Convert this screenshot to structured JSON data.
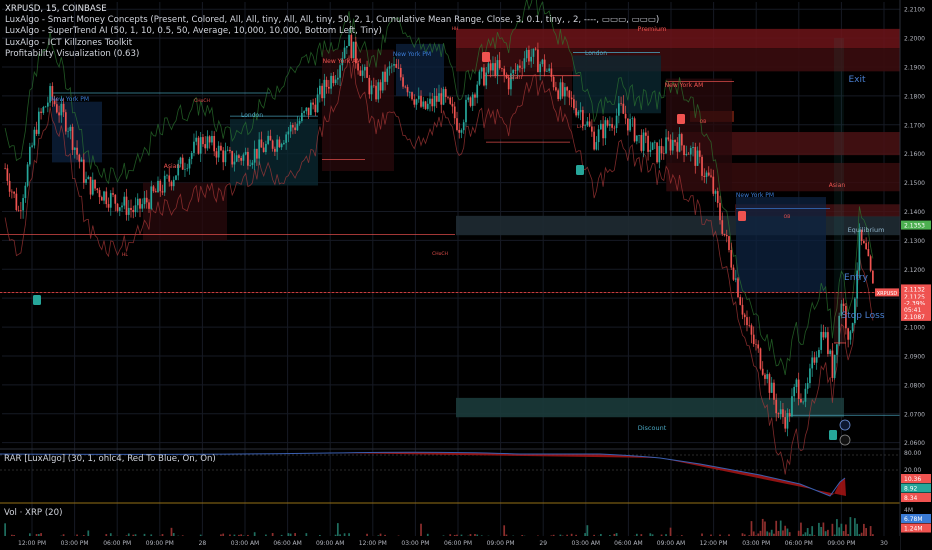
{
  "legend": {
    "symbol_line": "XRPUSD, 15, COINBASE",
    "indicators": [
      "LuxAlgo - Smart Money Concepts (Present, Colored, All, All, tiny, All, All, tiny, 50, 2, 1, Cumulative Mean Range, Close, 3, 0.1, tiny, , 2, ----, ▭▭▭, ▭▭▭)",
      "LuxAlgo - SuperTrend AI (50, 1, 10, 0.5, 50, Average, 10,000, 10,000, Bottom Left, Tiny)",
      "LuxAlgo - ICT Killzones Toolkit",
      "Profitability Visualization (0.63)"
    ]
  },
  "rar_label": "RAR [LuxAlgo] (30, 1, ohlc4, Red To Blue, On, On)",
  "vol_label": "Vol · XRP (20)",
  "colors": {
    "up": "#26a69a",
    "down": "#ef5350",
    "premium": "#8b1f24",
    "discount": "#1b3b3b",
    "session_ny": "#3a7bd5",
    "session_london": "#4aa6c0",
    "grid": "#161a24"
  },
  "price_axis": {
    "ticks": [
      "2.2100",
      "2.2000",
      "2.1900",
      "2.1800",
      "2.1700",
      "2.1600",
      "2.1500",
      "2.1400",
      "2.1300",
      "2.1200",
      "2.1100",
      "2.1000",
      "2.0900",
      "2.0800",
      "2.0700",
      "2.0600"
    ],
    "ymin": 2.0585,
    "ymax": 2.2125,
    "markers": [
      {
        "text": "2.1353",
        "price": 2.1353,
        "color": "#4caf50"
      },
      {
        "text": "2.1132",
        "price": 2.1132,
        "color": "#ef5350"
      },
      {
        "text": "2.1125",
        "price": 2.1105,
        "color": "#ef5350"
      },
      {
        "text": "-2.39%",
        "price": 2.1083,
        "color": "#ef5350"
      },
      {
        "text": "05:41",
        "price": 2.1061,
        "color": "#ef5350"
      },
      {
        "text": "2.1087",
        "price": 2.1037,
        "color": "#ef5350"
      }
    ],
    "flag": {
      "text": "XRPUSD",
      "price": 2.112
    }
  },
  "rar_axis": {
    "ticks": [
      "80.00",
      "20.00"
    ],
    "markers": [
      {
        "text": "10.36",
        "color": "#ef5350"
      },
      {
        "text": "8.92",
        "color": "#26a69a"
      },
      {
        "text": "8.34",
        "color": "#ef5350"
      }
    ]
  },
  "vol_axis": {
    "ticks": [
      "4M"
    ],
    "markers": [
      {
        "text": "6.78M",
        "color": "#3a7bd5"
      },
      {
        "text": "1.24M",
        "color": "#ef5350"
      }
    ]
  },
  "time_axis": [
    "12:00 PM",
    "03:00 PM",
    "06:00 PM",
    "09:00 PM",
    "28",
    "03:00 AM",
    "06:00 AM",
    "09:00 AM",
    "12:00 PM",
    "03:00 PM",
    "06:00 PM",
    "09:00 PM",
    "29",
    "03:00 AM",
    "06:00 AM",
    "09:00 AM",
    "12:00 PM",
    "03:00 PM",
    "06:00 PM",
    "09:00 PM",
    "30"
  ],
  "annotations": {
    "premium": "Premium",
    "discount": "Discount",
    "equilibrium": "Equilibrium",
    "exit": "Exit",
    "entry": "Entry",
    "stop_loss": "Stop Loss",
    "sessions": [
      {
        "text": "New York PM",
        "x": 70,
        "y": 101,
        "color": "#3a7bd5"
      },
      {
        "text": "London",
        "x": 252,
        "y": 117,
        "color": "#4aa6c0"
      },
      {
        "text": "Asian",
        "x": 172,
        "y": 168,
        "color": "#ef5350"
      },
      {
        "text": "New York AM",
        "x": 342,
        "y": 63,
        "color": "#ef5350"
      },
      {
        "text": "New York PM",
        "x": 412,
        "y": 56,
        "color": "#3a7bd5"
      },
      {
        "text": "Asian",
        "x": 514,
        "y": 79,
        "color": "#ef5350"
      },
      {
        "text": "London",
        "x": 596,
        "y": 55,
        "color": "#4aa6c0"
      },
      {
        "text": "New York AM",
        "x": 684,
        "y": 87,
        "color": "#ef5350"
      },
      {
        "text": "New York PM",
        "x": 755,
        "y": 197,
        "color": "#3a7bd5"
      },
      {
        "text": "Asian",
        "x": 837,
        "y": 187,
        "color": "#ef5350"
      }
    ],
    "tiny": [
      {
        "text": "CHoCH",
        "x": 202,
        "y": 102
      },
      {
        "text": "CHoCH",
        "x": 440,
        "y": 255
      },
      {
        "text": "HH",
        "x": 455,
        "y": 30
      },
      {
        "text": "HL",
        "x": 125,
        "y": 256
      },
      {
        "text": "OB",
        "x": 703,
        "y": 123
      },
      {
        "text": "OB",
        "x": 787,
        "y": 218
      },
      {
        "text": "LH",
        "x": 580,
        "y": 128
      }
    ]
  },
  "chart_data": {
    "type": "candlestick",
    "symbol": "XRPUSD",
    "interval": "15",
    "exchange": "COINBASE",
    "ylim": [
      2.0585,
      2.2125
    ],
    "last_price": 2.1132,
    "change_percent": "-2.39%",
    "levels": {
      "equilibrium": 2.1353
    },
    "close_path_keypoints": [
      [
        0,
        2.155
      ],
      [
        6,
        2.14
      ],
      [
        14,
        2.17
      ],
      [
        20,
        2.18
      ],
      [
        28,
        2.17
      ],
      [
        36,
        2.15
      ],
      [
        46,
        2.145
      ],
      [
        58,
        2.14
      ],
      [
        72,
        2.15
      ],
      [
        88,
        2.165
      ],
      [
        100,
        2.158
      ],
      [
        110,
        2.16
      ],
      [
        120,
        2.164
      ],
      [
        132,
        2.172
      ],
      [
        140,
        2.18
      ],
      [
        148,
        2.19
      ],
      [
        152,
        2.2
      ],
      [
        158,
        2.19
      ],
      [
        164,
        2.18
      ],
      [
        172,
        2.19
      ],
      [
        178,
        2.185
      ],
      [
        186,
        2.175
      ],
      [
        194,
        2.18
      ],
      [
        202,
        2.17
      ],
      [
        210,
        2.185
      ],
      [
        218,
        2.19
      ],
      [
        224,
        2.185
      ],
      [
        232,
        2.195
      ],
      [
        240,
        2.19
      ],
      [
        248,
        2.18
      ],
      [
        256,
        2.175
      ],
      [
        262,
        2.165
      ],
      [
        268,
        2.17
      ],
      [
        274,
        2.175
      ],
      [
        282,
        2.165
      ],
      [
        290,
        2.16
      ],
      [
        298,
        2.165
      ],
      [
        306,
        2.16
      ],
      [
        314,
        2.15
      ],
      [
        324,
        2.12
      ],
      [
        330,
        2.1
      ],
      [
        338,
        2.085
      ],
      [
        344,
        2.07
      ],
      [
        348,
        2.068
      ],
      [
        352,
        2.08
      ],
      [
        356,
        2.075
      ],
      [
        360,
        2.09
      ],
      [
        364,
        2.1
      ],
      [
        368,
        2.085
      ],
      [
        372,
        2.11
      ],
      [
        376,
        2.095
      ],
      [
        380,
        2.13
      ],
      [
        383,
        2.125
      ],
      [
        386,
        2.113
      ]
    ]
  }
}
